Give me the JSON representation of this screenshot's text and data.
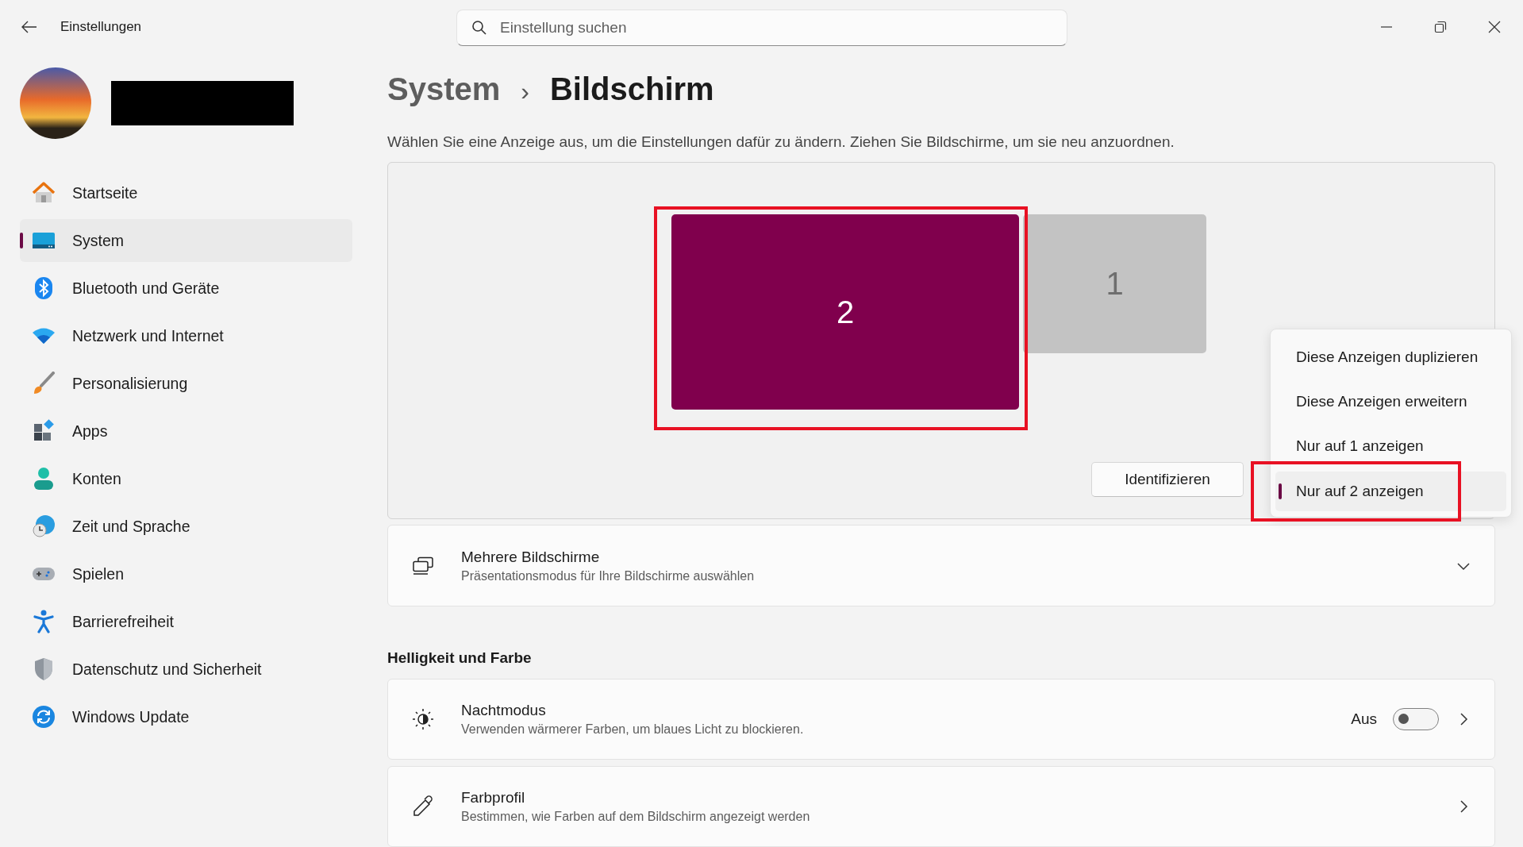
{
  "window": {
    "title": "Einstellungen"
  },
  "search": {
    "placeholder": "Einstellung suchen"
  },
  "sidebar": {
    "items": [
      {
        "label": "Startseite",
        "kind": "home",
        "selected": false
      },
      {
        "label": "System",
        "kind": "system",
        "selected": true
      },
      {
        "label": "Bluetooth und Geräte",
        "kind": "bluetooth",
        "selected": false
      },
      {
        "label": "Netzwerk und Internet",
        "kind": "network",
        "selected": false
      },
      {
        "label": "Personalisierung",
        "kind": "brush",
        "selected": false
      },
      {
        "label": "Apps",
        "kind": "apps",
        "selected": false
      },
      {
        "label": "Konten",
        "kind": "account",
        "selected": false
      },
      {
        "label": "Zeit und Sprache",
        "kind": "time",
        "selected": false
      },
      {
        "label": "Spielen",
        "kind": "gaming",
        "selected": false
      },
      {
        "label": "Barrierefreiheit",
        "kind": "accessibility",
        "selected": false
      },
      {
        "label": "Datenschutz und Sicherheit",
        "kind": "shield",
        "selected": false
      },
      {
        "label": "Windows Update",
        "kind": "update",
        "selected": false
      }
    ]
  },
  "breadcrumb": {
    "parent": "System",
    "separator": "›",
    "current": "Bildschirm"
  },
  "description": "Wählen Sie eine Anzeige aus, um die Einstellungen dafür zu ändern. Ziehen Sie Bildschirme, um sie neu anzuordnen.",
  "arrangement": {
    "monitors": [
      {
        "label": "2",
        "selected": true
      },
      {
        "label": "1",
        "selected": false
      }
    ],
    "identify_button": "Identifizieren"
  },
  "menu": {
    "items": [
      {
        "label": "Diese Anzeigen duplizieren",
        "selected": false
      },
      {
        "label": "Diese Anzeigen erweitern",
        "selected": false
      },
      {
        "label": "Nur auf 1 anzeigen",
        "selected": false
      },
      {
        "label": "Nur auf 2 anzeigen",
        "selected": true
      }
    ]
  },
  "multiple_displays": {
    "title": "Mehrere Bildschirme",
    "subtitle": "Präsentationsmodus für Ihre Bildschirme auswählen",
    "expanded": false
  },
  "brightness": {
    "heading": "Helligkeit und Farbe",
    "rows": [
      {
        "kind": "toggle",
        "title": "Nachtmodus",
        "subtitle": "Verwenden wärmerer Farben, um blaues Licht zu blockieren.",
        "state_label": "Aus",
        "on": false
      },
      {
        "kind": "link",
        "title": "Farbprofil",
        "subtitle": "Bestimmen, wie Farben auf dem Bildschirm angezeigt werden"
      }
    ]
  }
}
